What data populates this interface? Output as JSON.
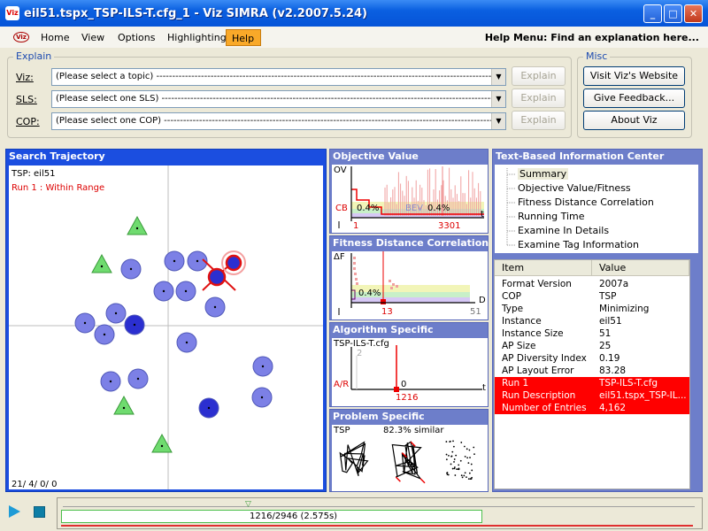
{
  "window": {
    "title": "eil51.tspx_TSP-ILS-T.cfg_1 - Viz SIMRA (v2.2007.5.24)",
    "app_icon_text": "Viz",
    "buttons": {
      "minimize": "_",
      "maximize": "□",
      "close": "✕"
    }
  },
  "menu": {
    "logo_text": "Viz",
    "items": [
      "Home",
      "View",
      "Options",
      "Highlighting",
      "Help"
    ],
    "active_index": 4,
    "help_text": "Help Menu: Find an explanation here..."
  },
  "explain": {
    "label": "Explain",
    "rows": [
      {
        "label": "Viz:",
        "value": "(Please select a topic) --------------------------------------------------------------------------------------------------------------------",
        "button": "Explain"
      },
      {
        "label": "SLS:",
        "value": "(Please select one SLS) ------------------------------------------------------------------------------------------------------------------",
        "button": "Explain"
      },
      {
        "label": "COP:",
        "value": "(Please select one COP) -----------------------------------------------------------------------------------------------------------------",
        "button": "Explain"
      }
    ]
  },
  "misc": {
    "label": "Misc",
    "buttons": [
      "Visit Viz's Website",
      "Give Feedback...",
      "About Viz"
    ]
  },
  "search_trajectory": {
    "title": "Search Trajectory",
    "line1": "TSP: eil51",
    "line2": "Run 1 : Within Range",
    "footer": "21/ 4/ 0/ 0"
  },
  "objective_value": {
    "title": "Objective Value",
    "y_label": "OV",
    "cb_label": "CB",
    "pct_left": "0.4%",
    "pct_right": "0.4%",
    "bev_label": "BEV",
    "x_start": "1",
    "x_end": "3301",
    "t_label": "t"
  },
  "fdc": {
    "title": "Fitness Distance Correlation",
    "y_label": "ΔF",
    "pct": "0.4%",
    "x_mark": "13",
    "x_end": "51",
    "d_label": "D"
  },
  "algorithm": {
    "title": "Algorithm Specific",
    "cfg": "TSP-ILS-T.cfg",
    "y_tick": "2",
    "ar_label": "A/R",
    "zero": "0",
    "x_mark": "1216",
    "t_label": "t"
  },
  "problem": {
    "title": "Problem Specific",
    "type": "TSP",
    "similarity": "82.3% similar"
  },
  "info_center": {
    "title": "Text-Based Information Center",
    "tree": [
      "Summary",
      "Objective Value/Fitness",
      "Fitness Distance Correlation",
      "Running Time",
      "Examine In Details",
      "Examine Tag Information"
    ],
    "selected_index": 0,
    "columns": [
      "Item",
      "Value"
    ],
    "rows": [
      {
        "item": "Format Version",
        "value": "2007a",
        "hl": false
      },
      {
        "item": "COP",
        "value": "TSP",
        "hl": false
      },
      {
        "item": "Type",
        "value": "Minimizing",
        "hl": false
      },
      {
        "item": "Instance",
        "value": "eil51",
        "hl": false
      },
      {
        "item": "Instance Size",
        "value": "51",
        "hl": false
      },
      {
        "item": "AP Size",
        "value": "25",
        "hl": false
      },
      {
        "item": "AP Diversity Index",
        "value": "0.19",
        "hl": false
      },
      {
        "item": "AP Layout Error",
        "value": "83.28",
        "hl": false
      },
      {
        "item": "Run 1",
        "value": "TSP-ILS-T.cfg",
        "hl": true
      },
      {
        "item": "Run Description",
        "value": "eil51.tspx_TSP-IL...",
        "hl": true
      },
      {
        "item": "Number of Entries",
        "value": "4,162",
        "hl": true
      }
    ]
  },
  "playback": {
    "progress_text": "1216/2946 (2.575s)",
    "progress": 0.413
  },
  "colors": {
    "title_blue": "#0a5fe0",
    "panel_blue": "#6d7eca",
    "circle_fill": "#7c80e6",
    "circle_dark": "#2b2fd0",
    "triangle_green": "#6fdb6f",
    "highlight_red": "#ff0000",
    "menu_active": "#f9a929"
  }
}
